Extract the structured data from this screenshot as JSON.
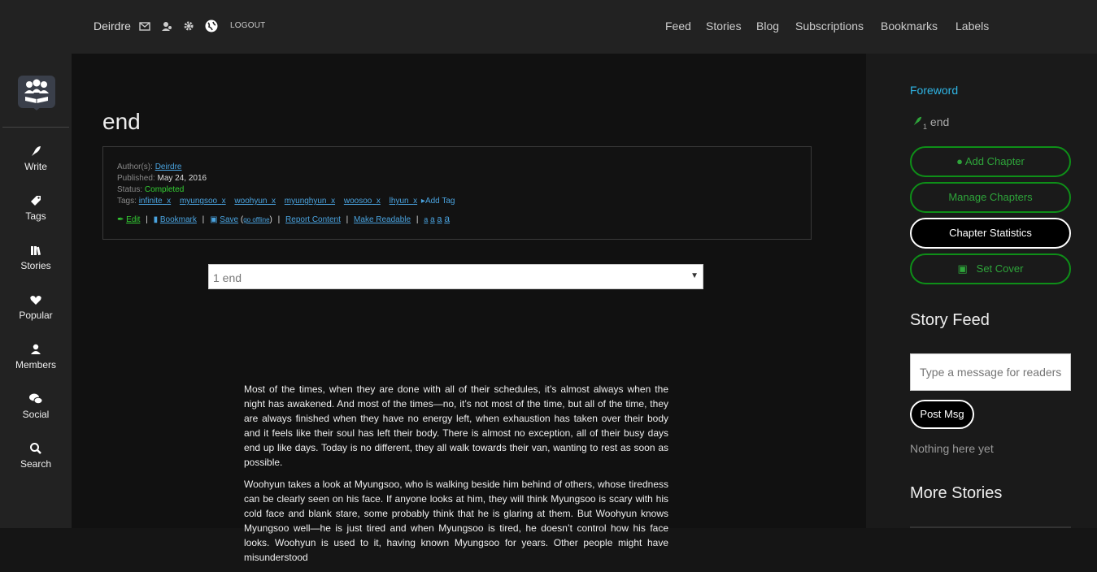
{
  "header": {
    "user_name": "Deirdre",
    "logout": "LOGOUT",
    "nav": [
      "Feed",
      "Stories",
      "Blog",
      "Subscriptions",
      "Bookmarks",
      "Labels"
    ]
  },
  "sidebar": {
    "items": [
      {
        "label": "Write",
        "icon": "feather-icon"
      },
      {
        "label": "Tags",
        "icon": "tag-icon"
      },
      {
        "label": "Stories",
        "icon": "books-icon"
      },
      {
        "label": "Popular",
        "icon": "heart-icon"
      },
      {
        "label": "Members",
        "icon": "member-icon"
      },
      {
        "label": "Social",
        "icon": "chat-icon"
      },
      {
        "label": "Search",
        "icon": "search-icon"
      }
    ]
  },
  "story": {
    "title": "end",
    "author_label": "Author(s):",
    "author": "Deirdre",
    "published_label": "Published:",
    "published": "May 24, 2016",
    "status_label": "Status:",
    "status": "Completed",
    "tags_label": "Tags:",
    "tags": [
      "infinite",
      "myungsoo",
      "woohyun",
      "myunghyun",
      "woosoo",
      "lhyun"
    ],
    "tag_remove": "x",
    "add_tag": "Add Tag",
    "actions": {
      "edit": "Edit",
      "bookmark": "Bookmark",
      "save": "Save",
      "go_offline": "go offline",
      "report": "Report Content",
      "readable": "Make Readable",
      "font_sizes": [
        "a",
        "a",
        "a",
        "a"
      ]
    },
    "chapter_select": "1 end",
    "paragraphs": [
      "Most of the times, when they are done with all of their schedules, it’s almost always when the night has awakened. And most of the times—no, it’s not most of the time, but all of the time, they are always finished when they have no energy left, when exhaustion has taken over their body and it feels like their soul has left their body. There is almost no exception, all of their busy days end up like days. Today is no different, they all walk towards their van, wanting to rest as soon as possible.",
      "Woohyun takes a look at Myungsoo, who is walking beside him behind of others, whose tiredness can be clearly seen on his face. If anyone looks at him, they will think Myungsoo is scary with his cold face and blank stare, some probably think that he is glaring at them. But Woohyun knows Myungsoo well—he is just tired and when Myungsoo is tired, he doesn’t control how his face looks. Woohyun is used to it, having known Myungsoo for years. Other people might have misunderstood"
    ]
  },
  "right": {
    "foreword": "Foreword",
    "chapter_num": "1",
    "chapter_name": "end",
    "add_chapter": "Add Chapter",
    "manage_chapters": "Manage Chapters",
    "chapter_statistics": "Chapter Statistics",
    "set_cover": "Set Cover",
    "story_feed": "Story Feed",
    "feed_placeholder": "Type a message for readers",
    "post_msg": "Post Msg",
    "empty_feed": "Nothing here yet",
    "more_stories": "More Stories"
  },
  "colors": {
    "accent_green": "#0e8f18",
    "link_blue": "#4aa3df",
    "foreword_blue": "#2fb6e6"
  }
}
